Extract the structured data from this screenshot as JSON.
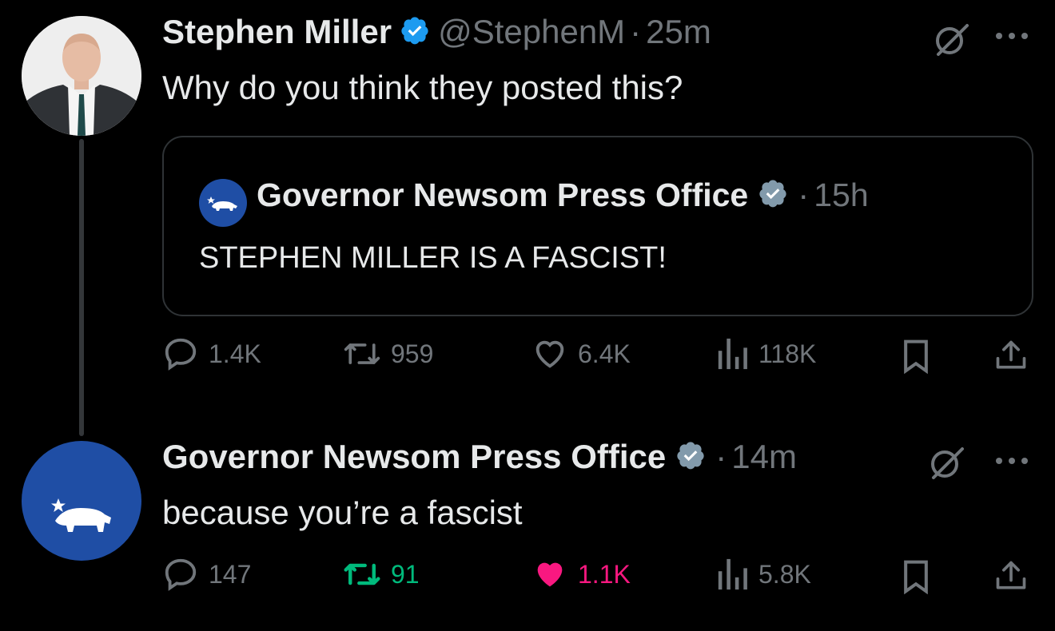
{
  "tweet1": {
    "name": "Stephen Miller",
    "handle": "@StephenM",
    "separator": "·",
    "time": "25m",
    "text": "Why do you think they posted this?",
    "quote": {
      "name": "Governor Newsom Press Office",
      "separator": "·",
      "time": "15h",
      "text": "STEPHEN MILLER IS A FASCIST!"
    },
    "stats": {
      "replies": "1.4K",
      "reposts": "959",
      "likes": "6.4K",
      "views": "118K"
    }
  },
  "tweet2": {
    "name": "Governor Newsom Press Office",
    "separator": "·",
    "time": "14m",
    "text": "because you’re a fascist",
    "stats": {
      "replies": "147",
      "reposts": "91",
      "likes": "1.1K",
      "views": "5.8K"
    }
  },
  "colors": {
    "background": "#000000",
    "text": "#e7e9ea",
    "muted": "#71767b",
    "verified_blue": "#1d9bf0",
    "verified_gray": "#829aab",
    "repost_green": "#00ba7c",
    "like_pink": "#f91880",
    "newsom_blue": "#1f4ea5"
  },
  "icons": [
    "grok-icon",
    "more-icon",
    "reply-icon",
    "repost-icon",
    "like-icon",
    "views-icon",
    "bookmark-icon",
    "share-icon",
    "verified-icon",
    "california-bear-icon"
  ]
}
